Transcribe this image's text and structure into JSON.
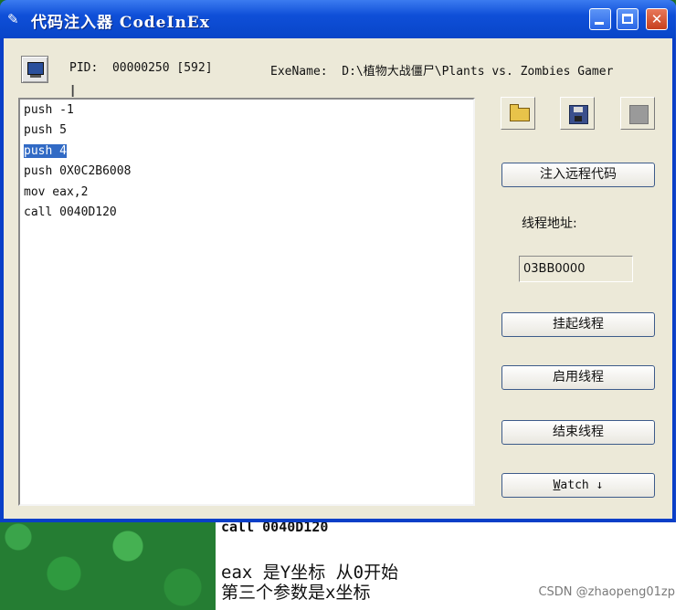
{
  "window": {
    "title": "代码注入器 CodeInEx"
  },
  "header": {
    "pid_text": "PID:  00000250 [592]",
    "exe_text": "ExeName:  D:\\植物大战僵尸\\Plants vs. Zombies Gamer"
  },
  "editor": {
    "lines": [
      "push -1",
      "push 5",
      "push 4",
      "push 0X0C2B6008",
      "mov eax,2",
      "call 0040D120"
    ],
    "selected_line": 2
  },
  "buttons": {
    "inject": "注入远程代码",
    "suspend": "挂起线程",
    "resume": "启用线程",
    "end": "结束线程",
    "watch_prefix": "W",
    "watch_rest": "atch ↓"
  },
  "thread": {
    "label": "线程地址:",
    "address": "03BB0000"
  },
  "background": {
    "line1": "call 0040D120",
    "line2": "eax 是Y坐标 从0开始",
    "line3": "第三个参数是x坐标",
    "watermark": "CSDN @zhaopeng01zp"
  }
}
